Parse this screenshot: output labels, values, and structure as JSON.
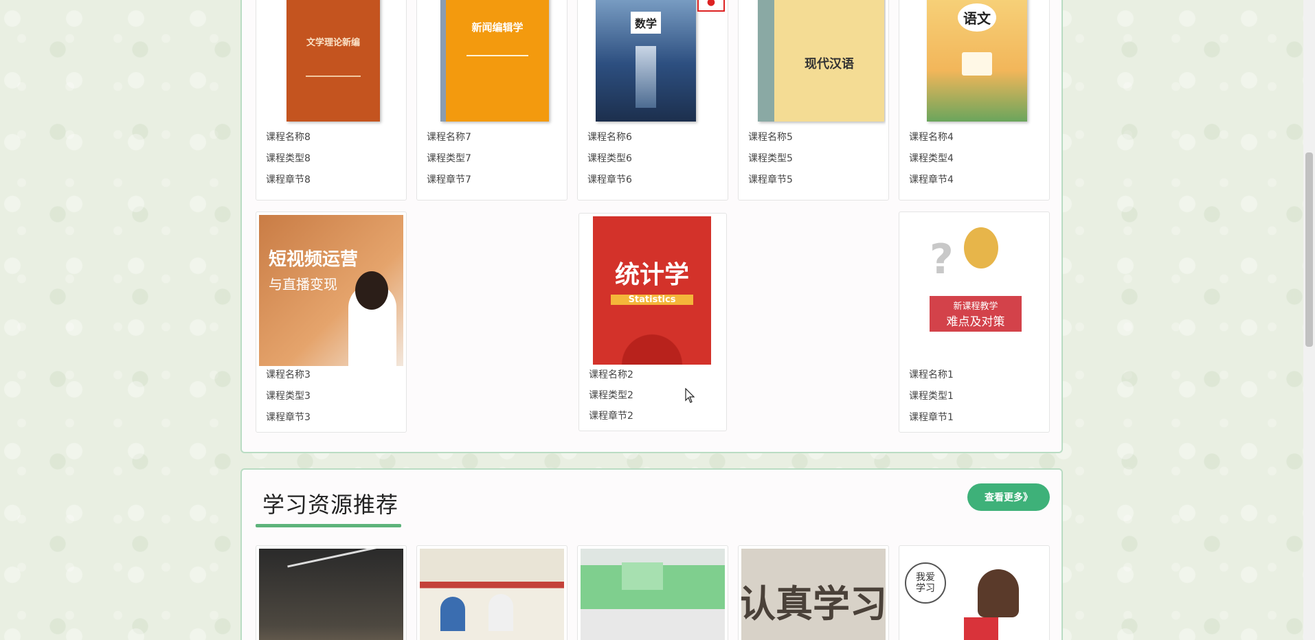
{
  "courses": [
    {
      "name": "课程名称8",
      "type": "课程类型8",
      "chapter": "课程章节8",
      "cover_title": "文学理论新编",
      "cover_color": "#c4541f"
    },
    {
      "name": "课程名称7",
      "type": "课程类型7",
      "chapter": "课程章节7",
      "cover_title": "新闻编辑学",
      "cover_color": "#f39a0e"
    },
    {
      "name": "课程名称6",
      "type": "课程类型6",
      "chapter": "课程章节6",
      "cover_title": "数学",
      "cover_color": "#2d4f80"
    },
    {
      "name": "课程名称5",
      "type": "课程类型5",
      "chapter": "课程章节5",
      "cover_title": "现代汉语",
      "cover_color": "#f4dc94"
    },
    {
      "name": "课程名称4",
      "type": "课程类型4",
      "chapter": "课程章节4",
      "cover_title": "语文",
      "cover_color": "#f2b65a"
    },
    {
      "name": "课程名称3",
      "type": "课程类型3",
      "chapter": "课程章节3",
      "cover_title": "短视频运营",
      "cover_subtitle": "与直播变现",
      "cover_color": "#d68a4e"
    },
    {
      "name": "课程名称2",
      "type": "课程类型2",
      "chapter": "课程章节2",
      "cover_title": "统计学",
      "cover_subtitle": "Statistics",
      "cover_color": "#d3322a"
    },
    {
      "name": "课程名称1",
      "type": "课程类型1",
      "chapter": "课程章节1",
      "cover_title": "新课程教学",
      "cover_subtitle": "难点及对策",
      "cover_color": "#d3424a"
    }
  ],
  "resources_section": {
    "title": "学习资源推荐",
    "more_label": "查看更多》"
  },
  "resources": [
    {
      "caption": ""
    },
    {
      "caption": ""
    },
    {
      "caption": ""
    },
    {
      "caption": "认真学习"
    },
    {
      "caption": "我爱学习"
    }
  ],
  "colors": {
    "accent": "#3eb179",
    "panel_border": "#b9dcc3",
    "underline": "#5db37b"
  }
}
